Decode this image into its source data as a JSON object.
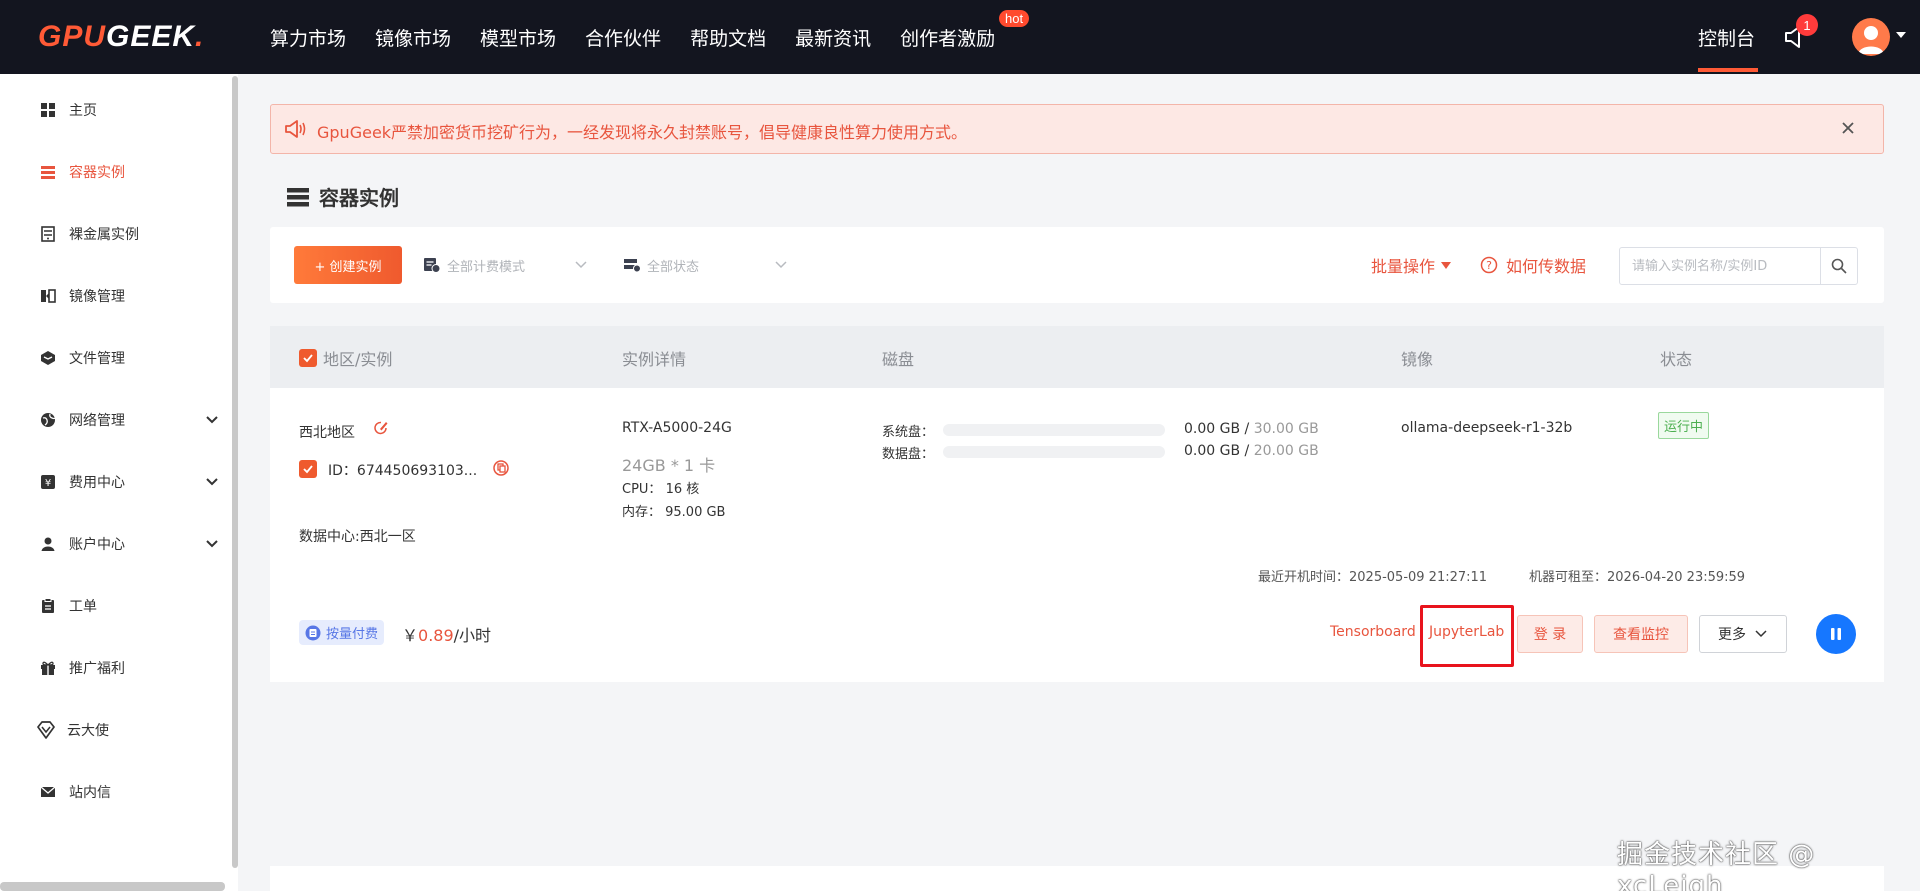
{
  "brand": {
    "part1": "GPU",
    "part2": "GEEK",
    "dot": "."
  },
  "nav": {
    "items": [
      "算力市场",
      "镜像市场",
      "模型市场",
      "合作伙伴",
      "帮助文档",
      "最新资讯",
      "创作者激励"
    ],
    "hot_badge": "hot",
    "console": "控制台",
    "notification_count": "1"
  },
  "sidebar": {
    "items": [
      {
        "label": "主页",
        "icon": "grid-icon"
      },
      {
        "label": "容器实例",
        "icon": "server-icon",
        "active": true
      },
      {
        "label": "裸金属实例",
        "icon": "baremetal-icon"
      },
      {
        "label": "镜像管理",
        "icon": "image-icon"
      },
      {
        "label": "文件管理",
        "icon": "box-icon"
      },
      {
        "label": "网络管理",
        "icon": "globe-icon",
        "expandable": true
      },
      {
        "label": "费用中心",
        "icon": "yen-icon",
        "expandable": true
      },
      {
        "label": "账户中心",
        "icon": "user-icon",
        "expandable": true
      },
      {
        "label": "工单",
        "icon": "clipboard-icon"
      },
      {
        "label": "推广福利",
        "icon": "gift-icon"
      },
      {
        "label": "云大使",
        "icon": "diamond-icon"
      },
      {
        "label": "站内信",
        "icon": "mail-icon"
      }
    ]
  },
  "notice": {
    "text": "GpuGeek严禁加密货币挖矿行为，一经发现将永久封禁账号，倡导健康良性算力使用方式。"
  },
  "page": {
    "title": "容器实例"
  },
  "toolbar": {
    "create_label": "+ 创建实例",
    "billing_filter": "全部计费模式",
    "status_filter": "全部状态",
    "batch_label": "批量操作",
    "howto_label": "如何传数据",
    "search_placeholder": "请输入实例名称/实例ID"
  },
  "table": {
    "headers": {
      "region": "地区/实例",
      "detail": "实例详情",
      "disk": "磁盘",
      "image": "镜像",
      "status": "状态"
    }
  },
  "instance": {
    "region": "西北地区",
    "id_label": "ID：",
    "id_value": "674450693103...",
    "datacenter": "数据中心:西北一区",
    "gpu": "RTX-A5000-24G",
    "gpu_spec": "24GB * 1 卡",
    "cpu": "CPU：  16 核",
    "memory": "内存：  95.00 GB",
    "system_disk_label": "系统盘：",
    "system_disk_used": "0.00 GB",
    "system_disk_total": "30.00 GB",
    "data_disk_label": "数据盘：",
    "data_disk_used": "0.00 GB",
    "data_disk_total": "20.00 GB",
    "slash": "/",
    "image": "ollama-deepseek-r1-32b",
    "status": "运行中",
    "last_boot": "最近开机时间：2025-05-09 21:27:11",
    "rent_until": "机器可租至：2026-04-20 23:59:59",
    "pay_mode": "按量付费",
    "price_currency": "￥",
    "price_value": "0.89",
    "price_unit": "/小时"
  },
  "actions": {
    "tensorboard": "Tensorboard",
    "jupyterlab": "JupyterLab",
    "login": "登 录",
    "monitor": "查看监控",
    "more": "更多"
  },
  "watermark": "掘金技术社区 @ xcLeigh",
  "colors": {
    "accent": "#e8553e",
    "nav_bg": "#13151f",
    "running": "#4caf50",
    "pause": "#1677ff"
  }
}
